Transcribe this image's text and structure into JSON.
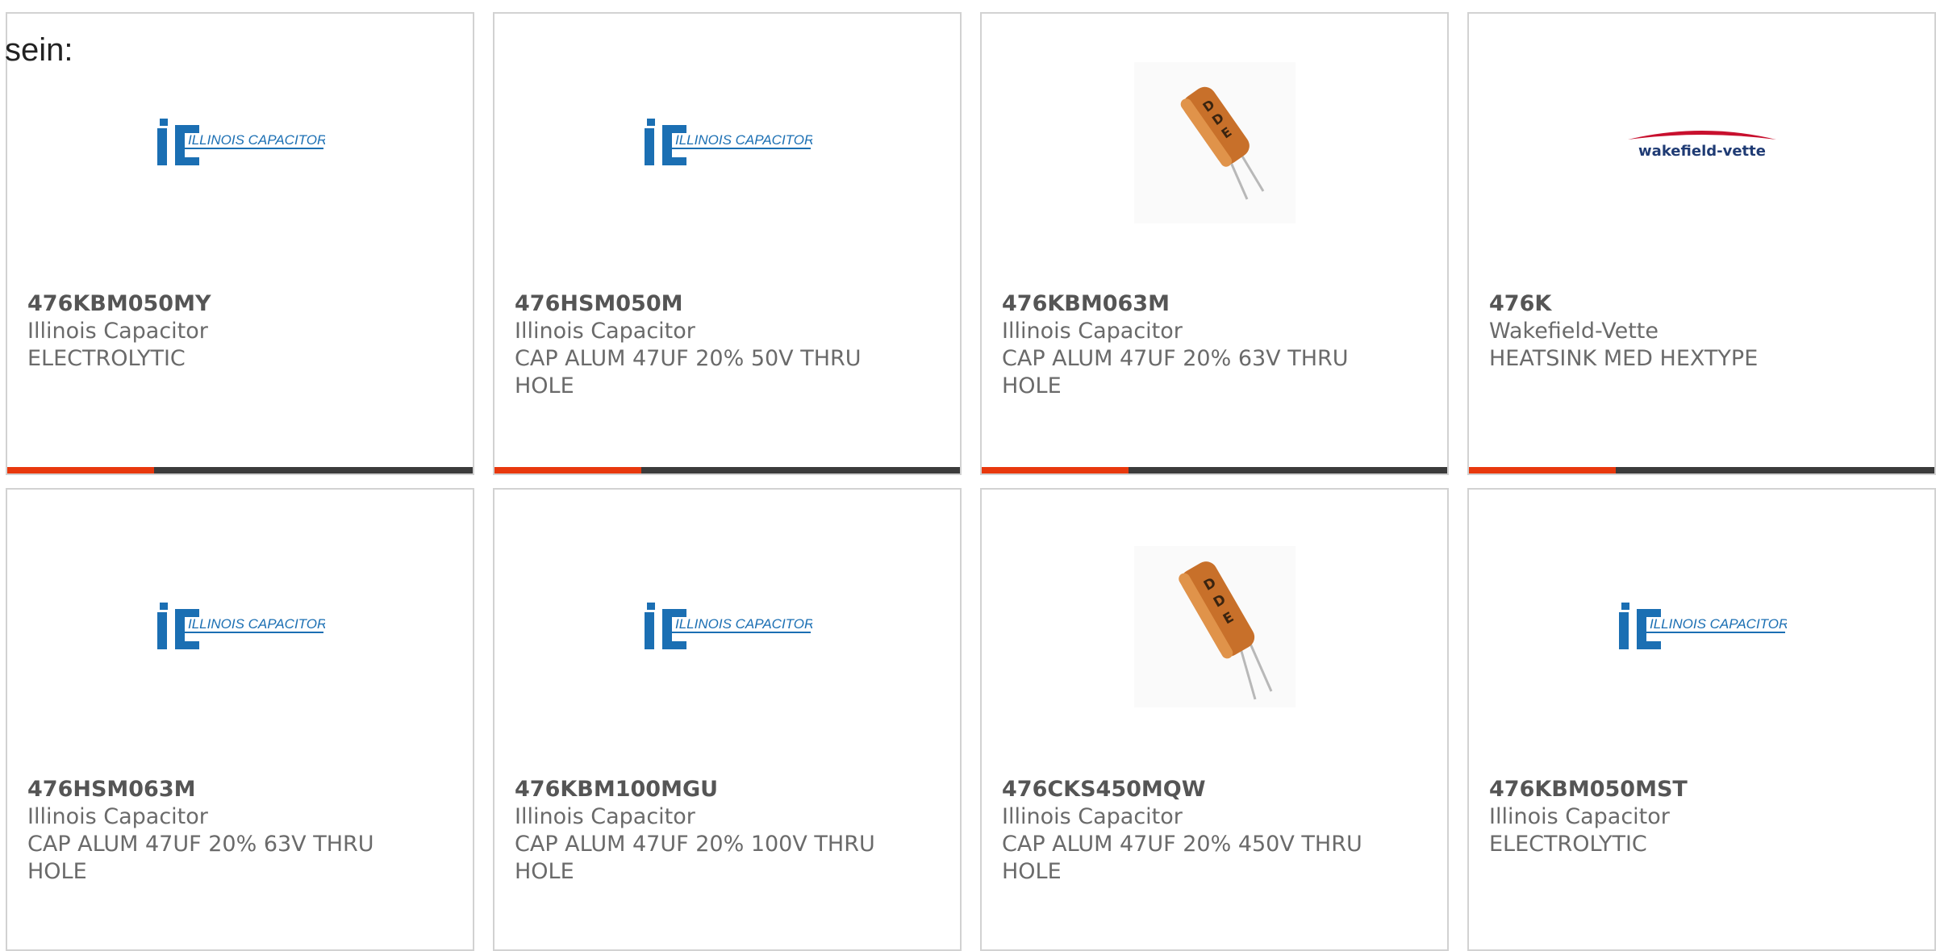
{
  "lead_text": "sein:",
  "colors": {
    "accent": "#e8380d",
    "bar_track": "#3b3b3b",
    "ic_blue": "#1b6fb3",
    "wakefield_red": "#c8102e"
  },
  "products": [
    {
      "part": "476KBM050MY",
      "manufacturer": "Illinois Capacitor",
      "description": "ELECTROLYTIC",
      "image": "illinois-capacitor-logo",
      "logo_text": "ILLINOIS CAPACITOR, INC.",
      "progress": 0.315
    },
    {
      "part": "476HSM050M",
      "manufacturer": "Illinois Capacitor",
      "description": "CAP ALUM 47UF 20% 50V THRU HOLE",
      "image": "illinois-capacitor-logo",
      "logo_text": "ILLINOIS CAPACITOR, INC.",
      "progress": 0.315
    },
    {
      "part": "476KBM063M",
      "manufacturer": "Illinois Capacitor",
      "description": "CAP ALUM 47UF 20% 63V THRU HOLE",
      "image": "capacitor-photo",
      "progress": 0.315
    },
    {
      "part": "476K",
      "manufacturer": "Wakefield-Vette",
      "description": "HEATSINK MED HEXTYPE",
      "image": "wakefield-vette-logo",
      "logo_text": "wakefield-vette",
      "progress": 0.315
    },
    {
      "part": "476HSM063M",
      "manufacturer": "Illinois Capacitor",
      "description": "CAP ALUM 47UF 20% 63V THRU HOLE",
      "image": "illinois-capacitor-logo",
      "logo_text": "ILLINOIS CAPACITOR, INC."
    },
    {
      "part": "476KBM100MGU",
      "manufacturer": "Illinois Capacitor",
      "description": "CAP ALUM 47UF 20% 100V THRU HOLE",
      "image": "illinois-capacitor-logo",
      "logo_text": "ILLINOIS CAPACITOR, INC."
    },
    {
      "part": "476CKS450MQW",
      "manufacturer": "Illinois Capacitor",
      "description": "CAP ALUM 47UF 20% 450V THRU HOLE",
      "image": "capacitor-photo"
    },
    {
      "part": "476KBM050MST",
      "manufacturer": "Illinois Capacitor",
      "description": "ELECTROLYTIC",
      "image": "illinois-capacitor-logo",
      "logo_text": "ILLINOIS CAPACITOR, INC."
    }
  ]
}
